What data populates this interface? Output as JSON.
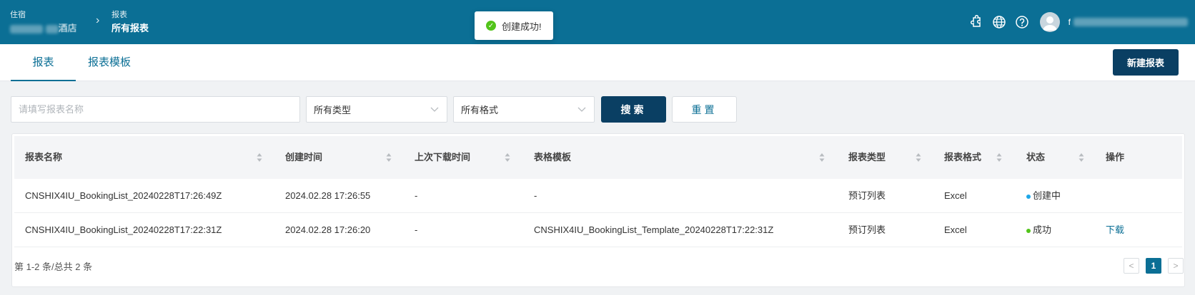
{
  "header": {
    "crumb1_top": "住宿",
    "crumb1_bottom": "酒店",
    "crumb2_top": "报表",
    "crumb2_bottom": "所有报表",
    "user_initial": "f",
    "icons": [
      "puzzle-icon",
      "globe-icon",
      "help-icon",
      "user-avatar-icon"
    ]
  },
  "toast": {
    "message": "创建成功!",
    "icon": "check-circle-icon"
  },
  "tabs": [
    {
      "label": "报表",
      "active": true
    },
    {
      "label": "报表模板",
      "active": false
    }
  ],
  "new_report_label": "新建报表",
  "filters": {
    "name_placeholder": "请填写报表名称",
    "type_value": "所有类型",
    "format_value": "所有格式",
    "search_label": "搜索",
    "reset_label": "重置"
  },
  "table": {
    "columns": [
      "报表名称",
      "创建时间",
      "上次下载时间",
      "表格模板",
      "报表类型",
      "报表格式",
      "状态",
      "操作"
    ],
    "rows": [
      {
        "name": "CNSHIX4IU_BookingList_20240228T17:26:49Z",
        "created": "2024.02.28 17:26:55",
        "last_download": "-",
        "template": "-",
        "type": "预订列表",
        "format": "Excel",
        "status": "创建中",
        "status_color": "#1ea7e8",
        "action": ""
      },
      {
        "name": "CNSHIX4IU_BookingList_20240228T17:22:31Z",
        "created": "2024.02.28 17:26:20",
        "last_download": "-",
        "template": "CNSHIX4IU_BookingList_Template_20240228T17:22:31Z",
        "type": "预订列表",
        "format": "Excel",
        "status": "成功",
        "status_color": "#52c41a",
        "action": "下载"
      }
    ]
  },
  "pagination": {
    "summary": "第 1-2 条/总共 2 条",
    "current_page": "1",
    "prev": "<",
    "next": ">"
  },
  "colors": {
    "header_bg": "#0b6f95",
    "primary_button": "#0a3f63"
  }
}
